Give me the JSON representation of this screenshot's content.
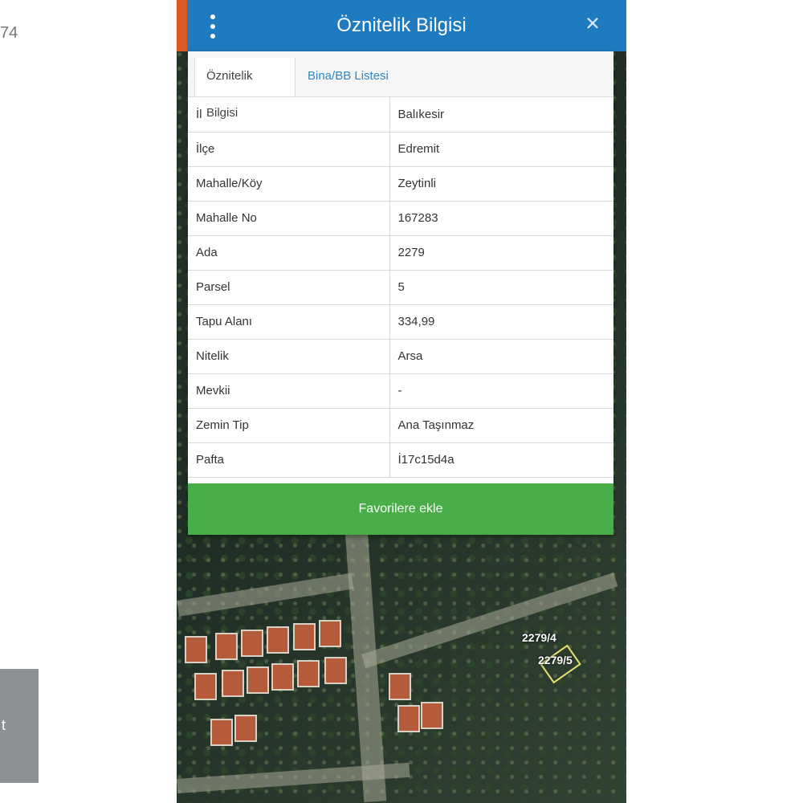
{
  "left_fragments": {
    "top_text": "74",
    "button_text": "t"
  },
  "header": {
    "title": "Öznitelik Bilgisi",
    "close_symbol": "×",
    "colors": {
      "header": "#1f7bbf",
      "left_strip": "#d85b27",
      "action": "#49ad4a"
    }
  },
  "tabs": [
    {
      "label": "Öznitelik Bilgisi",
      "active": true
    },
    {
      "label": "Bina/BB Listesi",
      "active": false
    }
  ],
  "attributes": [
    {
      "label": "İl",
      "value": "Balıkesir"
    },
    {
      "label": "İlçe",
      "value": "Edremit"
    },
    {
      "label": "Mahalle/Köy",
      "value": "Zeytinli"
    },
    {
      "label": "Mahalle No",
      "value": "167283"
    },
    {
      "label": "Ada",
      "value": "2279"
    },
    {
      "label": "Parsel",
      "value": "5"
    },
    {
      "label": "Tapu Alanı",
      "value": "334,99"
    },
    {
      "label": "Nitelik",
      "value": "Arsa"
    },
    {
      "label": "Mevkii",
      "value": "-"
    },
    {
      "label": "Zemin Tip",
      "value": "Ana Taşınmaz"
    },
    {
      "label": "Pafta",
      "value": "İ17c15d4a"
    }
  ],
  "actions": {
    "favorite_label": "Favorilere ekle"
  },
  "map": {
    "parcel_labels": [
      "2279/4",
      "2279/5"
    ]
  },
  "icons": {
    "menu": "vertical-ellipsis-icon",
    "close": "close-icon"
  }
}
